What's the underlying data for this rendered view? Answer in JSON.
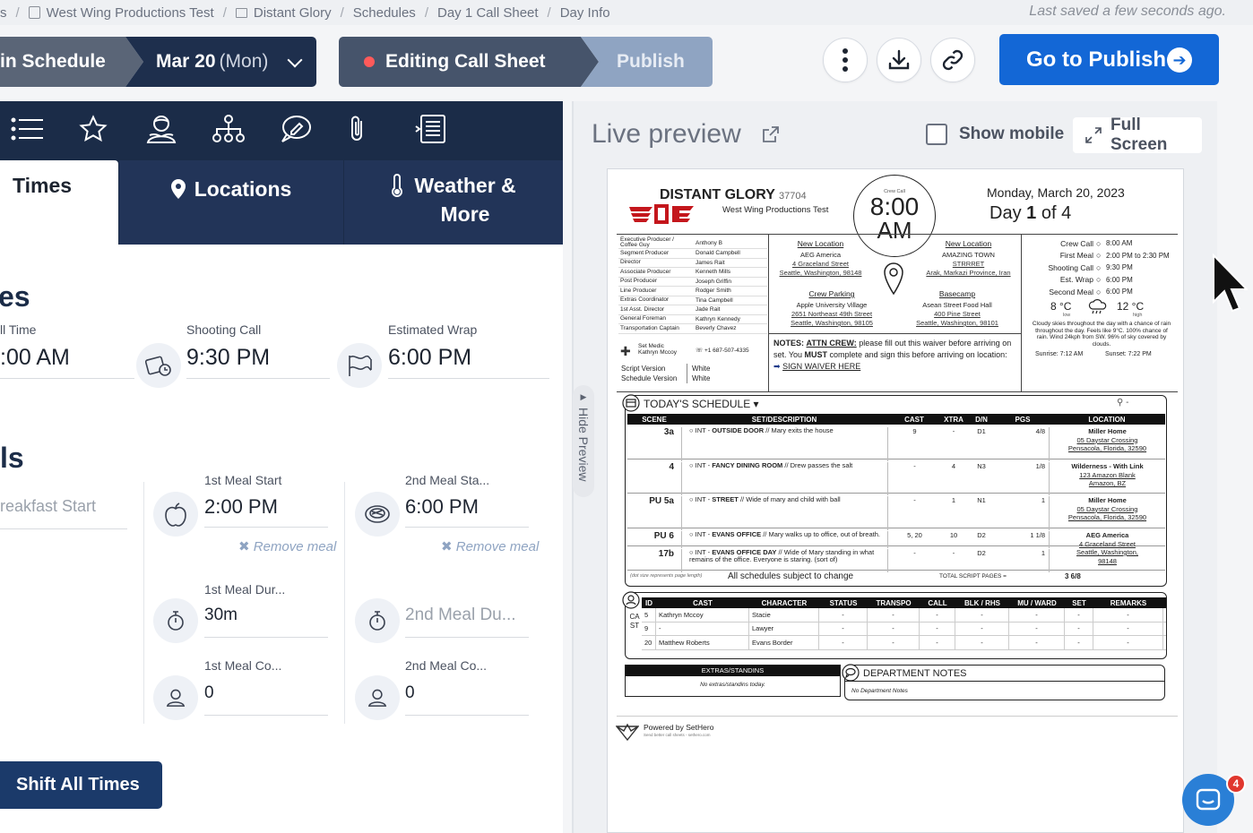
{
  "breadcrumb": {
    "items": [
      "s",
      "West Wing Productions Test",
      "Distant Glory",
      "Schedules",
      "Day 1 Call Sheet",
      "Day Info"
    ],
    "saved": "Last saved a few seconds ago."
  },
  "toolbar": {
    "main_schedule": "in Schedule",
    "date": "Mar 20",
    "weekday": "(Mon)",
    "editing": "Editing Call Sheet",
    "publish": "Publish",
    "go_publish": "Go to Publish"
  },
  "tabs": {
    "times": "Times",
    "locations": "Locations",
    "weather_line1": "Weather &",
    "weather_line2": "More"
  },
  "times": {
    "section_title": "es",
    "call_label": "ll Time",
    "call_value": ":00 AM",
    "shooting_label": "Shooting Call",
    "shooting_value": "9:30 PM",
    "wrap_label": "Estimated Wrap",
    "wrap_value": "6:00 PM"
  },
  "meals": {
    "section_title": "ls",
    "breakfast_placeholder": "reakfast Start",
    "m1_start_label": "1st Meal Start",
    "m1_start": "2:00 PM",
    "m2_start_label": "2nd Meal Sta...",
    "m2_start": "6:00 PM",
    "remove": "Remove meal",
    "m1_dur_label": "1st Meal Dur...",
    "m1_dur": "30m",
    "m2_dur_placeholder": "2nd Meal Du...",
    "m1_co_label": "1st Meal Co...",
    "m1_co": "0",
    "m2_co_label": "2nd Meal Co...",
    "m2_co": "0"
  },
  "shift_all": "Shift All Times",
  "hide_preview": "Hide Preview",
  "preview": {
    "title": "Live preview",
    "show_mobile": "Show mobile",
    "full_screen": "Full Screen"
  },
  "sheet": {
    "project": "DISTANT GLORY",
    "project_num": "37704",
    "company": "West Wing Productions Test",
    "crew_call_small": "Crew Call",
    "crew_call": "8:00",
    "crew_call_ampm": "AM",
    "date": "Monday, March 20, 2023",
    "day_prefix": "Day",
    "day_num": "1",
    "day_of": "of 4",
    "crew": [
      [
        "Executive Producer / Coffee Guy",
        "Anthony B"
      ],
      [
        "Segment Producer",
        "Donald Campbell"
      ],
      [
        "Director",
        "James Rait"
      ],
      [
        "Associate Producer",
        "Kenneth Mills"
      ],
      [
        "Post Producer",
        "Joseph Griffin"
      ],
      [
        "Line Producer",
        "Rodger Smith"
      ],
      [
        "Extras Coordinator",
        "Tina Campbell"
      ],
      [
        "1st Asst. Director",
        "Jade Rait"
      ],
      [
        "General Foreman",
        "Kathryn Kennedy"
      ],
      [
        "Transportation Captain",
        "Beverly Chavez"
      ]
    ],
    "medic_label": "Set Medic",
    "medic_name": "Kathryn Mccoy",
    "medic_phone": "+1 687-507-4335",
    "script_version_label": "Script Version",
    "script_version": "White",
    "schedule_version_label": "Schedule Version",
    "schedule_version": "White",
    "loc1": {
      "title": "New Location",
      "name": "AEG America",
      "addr1": "4 Graceland Street",
      "addr2": "Seattle, Washington, 98148"
    },
    "loc2": {
      "title": "New Location",
      "name": "AMAZING TOWN",
      "addr1": "STRRRET",
      "addr2": "Arak, Markazi Province, Iran"
    },
    "parking": {
      "title": "Crew Parking",
      "name": "Apple University Village",
      "addr1": "2651 Northeast 49th Street",
      "addr2": "Seattle, Washington, 98105"
    },
    "basecamp": {
      "title": "Basecamp",
      "name": "Asean Street Food Hall",
      "addr1": "400 Pine Street",
      "addr2": "Seattle, Washington, 98101"
    },
    "times": [
      [
        "Crew Call",
        "8:00 AM"
      ],
      [
        "First Meal",
        "2:00 PM to 2:30 PM"
      ],
      [
        "Shooting Call",
        "9:30 PM"
      ],
      [
        "Est. Wrap",
        "6:00 PM"
      ],
      [
        "Second Meal",
        "6:00 PM"
      ]
    ],
    "wx": {
      "low": "8 °C",
      "low_lbl": "low",
      "high": "12 °C",
      "high_lbl": "high",
      "desc": "Cloudy skies throughout the day with a chance of rain throughout the day. Feels like 9°C. 100% chance of rain. Wind 24kph from SW. 96% of sky covered by clouds.",
      "sunrise": "Sunrise: 7:12 AM",
      "sunset": "Sunset: 7:22 PM"
    },
    "notes": {
      "label": "NOTES:",
      "attn": "ATTN CREW:",
      "t1": " please fill out this waiver before arriving on set. You ",
      "must": "MUST",
      "t2": " complete and sign this before arriving on location:",
      "link": "SIGN WAIVER HERE"
    },
    "schedule_title": "TODAY'S SCHEDULE",
    "sched_headers": [
      "SCENE",
      "SET/DESCRIPTION",
      "CAST",
      "XTRA",
      "D/N",
      "PGS",
      "LOCATION"
    ],
    "scenes": [
      {
        "scene": "3a",
        "ie": "INT",
        "set": "OUTSIDE DOOR",
        "desc": "// Mary exits the house",
        "cast": "9",
        "xtra": "-",
        "dn": "D1",
        "pgs": "4/8",
        "loc": "Miller Home",
        "la1": "05 Daystar Crossing",
        "la2": "Pensacola, Florida, 32590"
      },
      {
        "scene": "4",
        "ie": "INT",
        "set": "FANCY DINING ROOM",
        "desc": "// Drew passes the salt",
        "cast": "-",
        "xtra": "4",
        "dn": "N3",
        "pgs": "1/8",
        "loc": "Wilderness - With Link",
        "la1": "123 Amazon Blank",
        "la2": "Amazon, BZ"
      },
      {
        "scene": "PU 5a",
        "ie": "INT",
        "set": "STREET",
        "desc": "// Wide of mary and child with ball",
        "cast": "-",
        "xtra": "1",
        "dn": "N1",
        "pgs": "1",
        "loc": "Miller Home",
        "la1": "05 Daystar Crossing",
        "la2": "Pensacola, Florida, 32590"
      },
      {
        "scene": "PU 6",
        "ie": "INT",
        "set": "EVANS OFFICE",
        "desc": "// Mary walks up to office, out of breath.",
        "cast": "5, 20",
        "xtra": "10",
        "dn": "D2",
        "pgs": "1 1/8",
        "loc": "AEG America",
        "la1": "4 Graceland Street",
        "la2": "Seattle, Washington,",
        "la3": "98148"
      },
      {
        "scene": "17b",
        "ie": "INT",
        "set": "EVANS OFFICE DAY",
        "desc": "// Wide of Mary standing in what remains of the office. Everyone is staring. (sort of)",
        "cast": "-",
        "xtra": "-",
        "dn": "D2",
        "pgs": "1",
        "loc": "",
        "la1": "",
        "la2": ""
      }
    ],
    "dot_note": "(dot size represents page length)",
    "subject": "All schedules subject to change",
    "total_label": "TOTAL SCRIPT PAGES =",
    "total": "3 6/8",
    "cast_headers": [
      "ID",
      "CAST",
      "CHARACTER",
      "STATUS",
      "TRANSPO",
      "CALL",
      "BLK / RHS",
      "MU / WARD",
      "SET",
      "REMARKS"
    ],
    "cast_side": "CAST",
    "cast": [
      [
        "5",
        "Kathryn Mccoy",
        "Stacie"
      ],
      [
        "9",
        "-",
        "Lawyer"
      ],
      [
        "20",
        "Matthew Roberts",
        "Evans Border"
      ]
    ],
    "extras_title": "EXTRAS/STANDINS",
    "extras_note": "No extras/standins today.",
    "dept_title": "DEPARTMENT NOTES",
    "dept_note": "No Department Notes",
    "powered": "Powered by SetHero",
    "powered_sub": "Send better call sheets - sethero.com"
  },
  "chat_badge": "4",
  "colors": {
    "navy": "#1b2c48",
    "accent": "#1367d6",
    "recording": "#ff5a5a"
  }
}
